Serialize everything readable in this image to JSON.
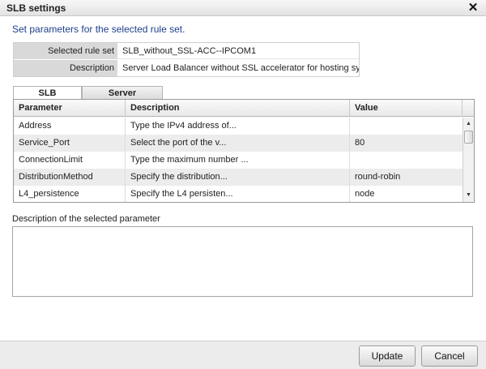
{
  "window": {
    "title": "SLB settings",
    "close_icon": "close-icon"
  },
  "instruction": "Set parameters for the selected rule set.",
  "rule_info": {
    "selected_label": "Selected rule set",
    "selected_value": "SLB_without_SSL-ACC--IPCOM1",
    "description_label": "Description",
    "description_value": "Server Load Balancer without SSL accelerator for hosting syst"
  },
  "tabs": [
    {
      "label": "SLB",
      "active": true
    },
    {
      "label": "Server",
      "active": false
    }
  ],
  "grid": {
    "columns": [
      "Parameter",
      "Description",
      "Value"
    ],
    "rows": [
      {
        "parameter": "Address",
        "description": "Type the IPv4 address of...",
        "value": ""
      },
      {
        "parameter": "Service_Port",
        "description": "Select the port of the v...",
        "value": "80"
      },
      {
        "parameter": "ConnectionLimit",
        "description": "Type the maximum number ...",
        "value": ""
      },
      {
        "parameter": "DistributionMethod",
        "description": "Specify the distribution...",
        "value": "round-robin"
      },
      {
        "parameter": "L4_persistence",
        "description": "Specify the L4 persisten...",
        "value": "node"
      }
    ]
  },
  "selected_description": {
    "label": "Description of the selected parameter",
    "text": ""
  },
  "buttons": {
    "update": "Update",
    "cancel": "Cancel"
  }
}
